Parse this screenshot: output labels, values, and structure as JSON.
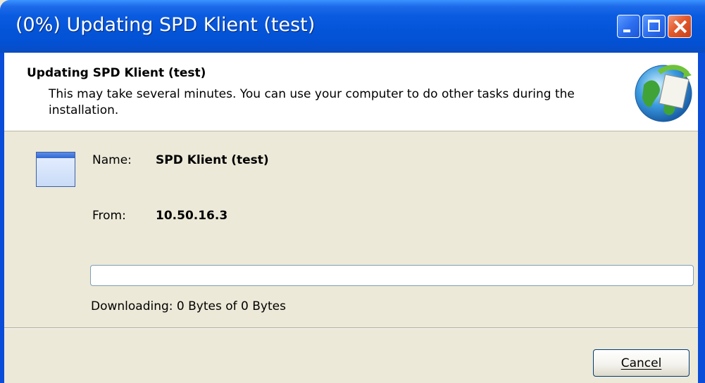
{
  "window": {
    "title": "(0%) Updating SPD Klient (test)",
    "controls": {
      "minimize": "minimize",
      "maximize": "maximize",
      "close": "close"
    }
  },
  "header": {
    "title": "Updating SPD Klient (test)",
    "description": "This may take several minutes. You can use your computer to do other tasks during the installation."
  },
  "details": {
    "name_label": "Name:",
    "name_value": "SPD Klient (test)",
    "from_label": "From:",
    "from_value": "10.50.16.3"
  },
  "progress": {
    "percent": 0,
    "status": "Downloading: 0 Bytes of 0 Bytes"
  },
  "buttons": {
    "cancel_label": "Cancel"
  },
  "colors": {
    "titlebar": "#0454D8",
    "dialog_bg": "#ECE9D8",
    "close_button": "#E35A2C"
  }
}
